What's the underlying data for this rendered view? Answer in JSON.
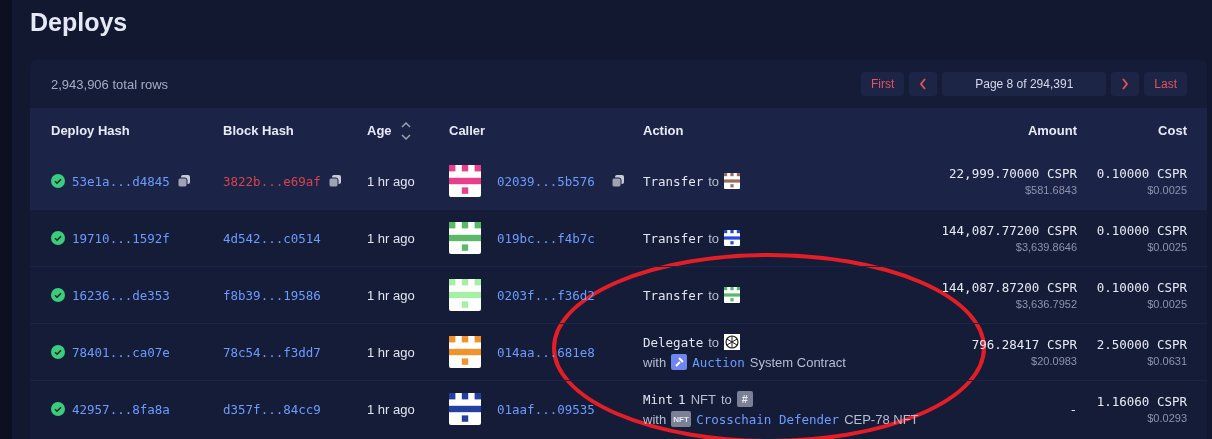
{
  "title": "Deploys",
  "total_rows": "2,943,906 total rows",
  "pagination": {
    "first": "First",
    "page_label": "Page 8 of 294,391",
    "last": "Last"
  },
  "columns": [
    {
      "label": "Deploy Hash",
      "sortable": false
    },
    {
      "label": "Block Hash",
      "sortable": false
    },
    {
      "label": "Age",
      "sortable": true
    },
    {
      "label": "Caller",
      "sortable": false
    },
    {
      "label": "Action",
      "sortable": false
    },
    {
      "label": "Amount",
      "sortable": false
    },
    {
      "label": "Cost",
      "sortable": false
    }
  ],
  "rows": [
    {
      "hovered": true,
      "succeeded": true,
      "deploy_hash": "53e1a...d4845",
      "block_hash": "3822b...e69af",
      "block_hash_highlighted": true,
      "age": "1 hr ago",
      "caller": {
        "hash": "02039...5b576",
        "color": "#e83e8c"
      },
      "action": {
        "kind": "transfer",
        "verb": "Transfer",
        "preposition": "to",
        "target": {
          "color": "#9c6b5a"
        }
      },
      "amount": "22,999.70000 CSPR",
      "amount_usd": "$581.6843",
      "cost": "0.10000 CSPR",
      "cost_usd": "$0.0025"
    },
    {
      "hovered": false,
      "succeeded": true,
      "deploy_hash": "19710...1592f",
      "block_hash": "4d542...c0514",
      "block_hash_highlighted": false,
      "age": "1 hr ago",
      "caller": {
        "hash": "019bc...f4b7c",
        "color": "#5bb86a"
      },
      "action": {
        "kind": "transfer",
        "verb": "Transfer",
        "preposition": "to",
        "target": {
          "color": "#2548e0"
        }
      },
      "amount": "144,087.77200 CSPR",
      "amount_usd": "$3,639.8646",
      "cost": "0.10000 CSPR",
      "cost_usd": "$0.0025"
    },
    {
      "hovered": false,
      "succeeded": true,
      "deploy_hash": "16236...de353",
      "block_hash": "f8b39...19586",
      "block_hash_highlighted": false,
      "age": "1 hr ago",
      "caller": {
        "hash": "0203f...f36d2",
        "color": "#a6f0a6"
      },
      "action": {
        "kind": "transfer",
        "verb": "Transfer",
        "preposition": "to",
        "target": {
          "color": "#5bb86a"
        }
      },
      "amount": "144,087.87200 CSPR",
      "amount_usd": "$3,636.7952",
      "cost": "0.10000 CSPR",
      "cost_usd": "$0.0025"
    },
    {
      "hovered": false,
      "succeeded": true,
      "deploy_hash": "78401...ca07e",
      "block_hash": "78c54...f3dd7",
      "block_hash_highlighted": false,
      "age": "1 hr ago",
      "caller": {
        "hash": "014aa...681e8",
        "color": "#f0932b"
      },
      "action": {
        "kind": "delegate",
        "verb": "Delegate",
        "preposition": "to",
        "with_label": "with",
        "contract_name": "Auction",
        "contract_suffix": "System Contract"
      },
      "amount": "796.28417 CSPR",
      "amount_usd": "$20.0983",
      "cost": "2.50000 CSPR",
      "cost_usd": "$0.0631"
    },
    {
      "hovered": false,
      "succeeded": true,
      "deploy_hash": "42957...8fa8a",
      "block_hash": "d357f...84cc9",
      "block_hash_highlighted": false,
      "age": "1 hr ago",
      "caller": {
        "hash": "01aaf...09535",
        "color": "#2340a0"
      },
      "action": {
        "kind": "mint",
        "verb": "Mint",
        "count": "1",
        "unit": "NFT",
        "preposition": "to",
        "target_badge": "#",
        "with_label": "with",
        "nft_badge": "NFT",
        "contract_name": "Crosschain Defender",
        "contract_suffix": "CEP-78 NFT"
      },
      "amount": "-",
      "cost": "1.16060 CSPR",
      "cost_usd": "$0.0293"
    }
  ]
}
